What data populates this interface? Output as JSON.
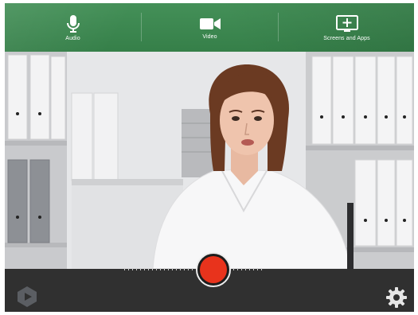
{
  "toolbar": {
    "items": [
      {
        "label": "Audio",
        "icon": "microphone-icon"
      },
      {
        "label": "Video",
        "icon": "video-camera-icon"
      },
      {
        "label": "Screens and Apps",
        "icon": "screen-plus-icon"
      }
    ],
    "background_color": "#3a8a4f"
  },
  "camera_view": {
    "content": "live camera preview"
  },
  "bottom_bar": {
    "record_button_color": "#e8331c",
    "left_icon": "app-logo-icon",
    "right_icon": "gear-icon"
  }
}
